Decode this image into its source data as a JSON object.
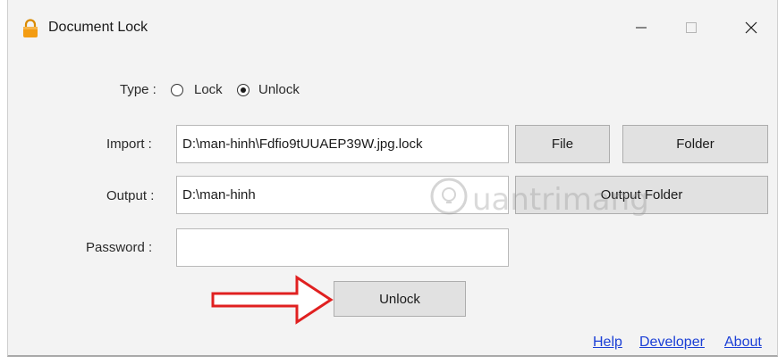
{
  "window": {
    "title": "Document Lock",
    "icon": "lock-icon",
    "accent": "#f39c12"
  },
  "type_row": {
    "label": "Type :",
    "options": [
      {
        "label": "Lock",
        "selected": false
      },
      {
        "label": "Unlock",
        "selected": true
      }
    ]
  },
  "import_row": {
    "label": "Import :",
    "value": "D:\\man-hinh\\Fdfio9tUUAEP39W.jpg.lock",
    "file_button": "File",
    "folder_button": "Folder"
  },
  "output_row": {
    "label": "Output :",
    "value": "D:\\man-hinh",
    "output_folder_button": "Output Folder"
  },
  "password_row": {
    "label": "Password :",
    "value": ""
  },
  "action": {
    "unlock_button": "Unlock"
  },
  "footer_links": {
    "help": "Help",
    "developer": "Developer",
    "about": "About"
  },
  "watermark": {
    "text": "uantrimang"
  },
  "colors": {
    "link": "#1b3fd6",
    "arrow": "#e02020",
    "button_bg": "#e1e1e1"
  }
}
